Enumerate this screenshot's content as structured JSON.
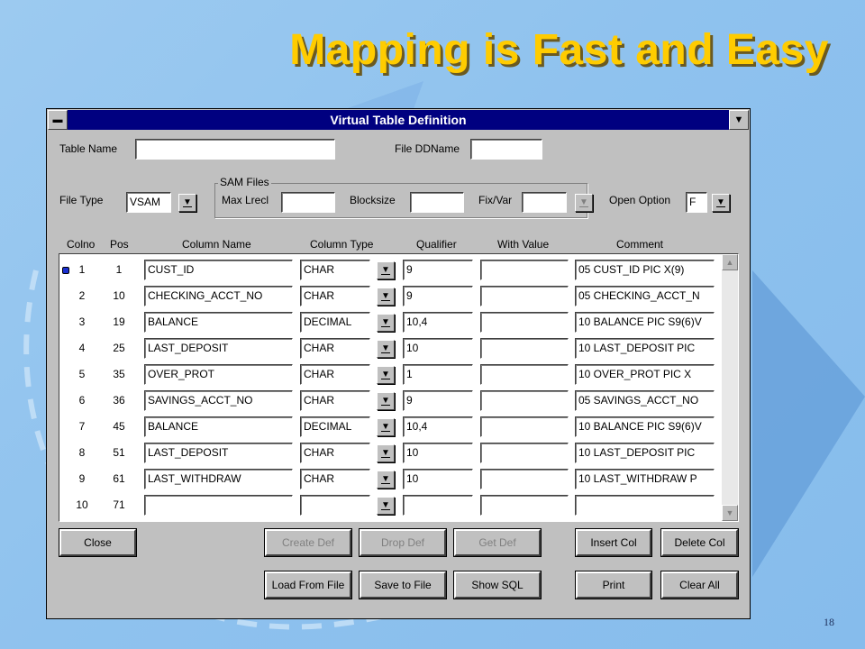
{
  "slide": {
    "title": "Mapping is Fast and Easy",
    "page_number": "18"
  },
  "window": {
    "title": "Virtual Table Definition"
  },
  "form": {
    "table_name_label": "Table Name",
    "table_name_value": "",
    "file_ddname_label": "File DDName",
    "file_ddname_value": "",
    "file_type_label": "File Type",
    "file_type_value": "VSAM",
    "sam_group_label": "SAM Files",
    "max_lrecl_label": "Max Lrecl",
    "max_lrecl_value": "",
    "blocksize_label": "Blocksize",
    "blocksize_value": "",
    "fixvar_label": "Fix/Var",
    "fixvar_value": "",
    "open_option_label": "Open Option",
    "open_option_value": "F"
  },
  "grid": {
    "headers": [
      "Colno",
      "Pos",
      "Column Name",
      "Column Type",
      "Qualifier",
      "With Value",
      "Comment"
    ],
    "rows": [
      {
        "colno": "1",
        "pos": "1",
        "name": "CUST_ID",
        "type": "CHAR",
        "qualifier": "9",
        "with_value": "",
        "comment": "05 CUST_ID PIC X(9)"
      },
      {
        "colno": "2",
        "pos": "10",
        "name": "CHECKING_ACCT_NO",
        "type": "CHAR",
        "qualifier": "9",
        "with_value": "",
        "comment": "05 CHECKING_ACCT_N"
      },
      {
        "colno": "3",
        "pos": "19",
        "name": "BALANCE",
        "type": "DECIMAL",
        "qualifier": "10,4",
        "with_value": "",
        "comment": "10 BALANCE PIC S9(6)V"
      },
      {
        "colno": "4",
        "pos": "25",
        "name": "LAST_DEPOSIT",
        "type": "CHAR",
        "qualifier": "10",
        "with_value": "",
        "comment": "10 LAST_DEPOSIT PIC"
      },
      {
        "colno": "5",
        "pos": "35",
        "name": "OVER_PROT",
        "type": "CHAR",
        "qualifier": "1",
        "with_value": "",
        "comment": "10 OVER_PROT PIC X"
      },
      {
        "colno": "6",
        "pos": "36",
        "name": "SAVINGS_ACCT_NO",
        "type": "CHAR",
        "qualifier": "9",
        "with_value": "",
        "comment": "05 SAVINGS_ACCT_NO"
      },
      {
        "colno": "7",
        "pos": "45",
        "name": "BALANCE",
        "type": "DECIMAL",
        "qualifier": "10,4",
        "with_value": "",
        "comment": "10 BALANCE PIC S9(6)V"
      },
      {
        "colno": "8",
        "pos": "51",
        "name": "LAST_DEPOSIT",
        "type": "CHAR",
        "qualifier": "10",
        "with_value": "",
        "comment": "10 LAST_DEPOSIT PIC"
      },
      {
        "colno": "9",
        "pos": "61",
        "name": "LAST_WITHDRAW",
        "type": "CHAR",
        "qualifier": "10",
        "with_value": "",
        "comment": "10 LAST_WITHDRAW P"
      },
      {
        "colno": "10",
        "pos": "71",
        "name": "",
        "type": "",
        "qualifier": "",
        "with_value": "",
        "comment": ""
      }
    ]
  },
  "buttons": {
    "close": "Close",
    "create_def": "Create Def",
    "drop_def": "Drop Def",
    "get_def": "Get Def",
    "insert_col": "Insert Col",
    "delete_col": "Delete Col",
    "load_from_file": "Load From File",
    "save_to_file": "Save to File",
    "show_sql": "Show SQL",
    "print": "Print",
    "clear_all": "Clear All"
  },
  "colors": {
    "title_gold": "#ffcc00",
    "titlebar_navy": "#000080",
    "dialog_gray": "#c0c0c0",
    "background_blue": "#8fc2ee"
  },
  "icons": [
    "window-menu-icon",
    "minimize-icon",
    "dropdown-arrow-icon",
    "scroll-up-icon",
    "scroll-down-icon",
    "row-selector-icon"
  ]
}
